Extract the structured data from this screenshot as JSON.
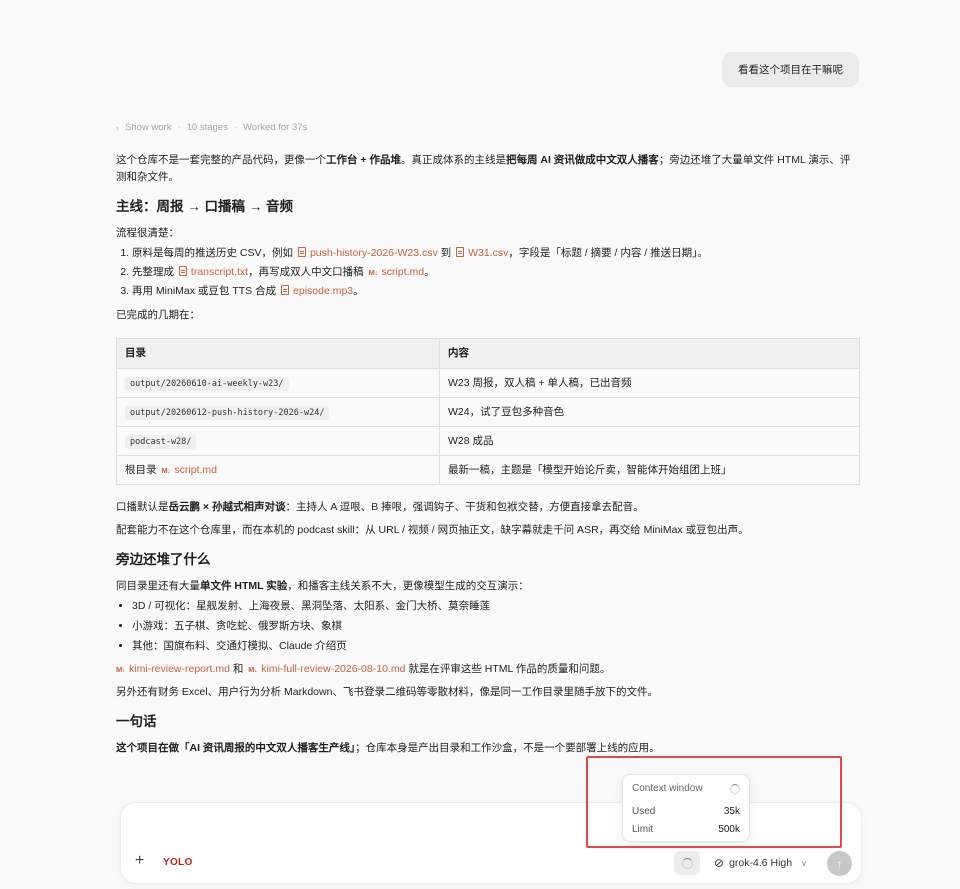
{
  "user_message": "看看这个项目在干嘛呢",
  "show_work": {
    "label": "Show work",
    "stages": "10 stages",
    "worked": "Worked for 37s"
  },
  "intro": {
    "t1": "这个仓库不是一套完整的产品代码，更像一个",
    "b1": "工作台 + 作品堆",
    "t2": "。真正成体系的主线是",
    "b2": "把每周 AI 资讯做成中文双人播客",
    "t3": "；旁边还堆了大量单文件 HTML 演示、评测和杂文件。"
  },
  "section1": {
    "heading": "主线：周报 → 口播稿 → 音频",
    "flow_intro": "流程很清楚：",
    "steps": [
      {
        "a": "原料是每周的推送历史 CSV，例如 ",
        "f1": "push-history-2026-W23.csv",
        "b": " 到 ",
        "f2": "W31.csv",
        "c": "，字段是「标题 / 摘要 / 内容 / 推送日期」。"
      },
      {
        "a": "先整理成 ",
        "f1": "transcript.txt",
        "b": "，再写成双人中文口播稿 ",
        "f2": "script.md",
        "c": "。"
      },
      {
        "a": "再用 MiniMax 或豆包 TTS 合成 ",
        "f1": "episode.mp3",
        "c": "。"
      }
    ],
    "done_label": "已完成的几期在："
  },
  "table": {
    "headers": [
      "目录",
      "内容"
    ],
    "rows": [
      {
        "dir": "output/20260610-ai-weekly-w23/",
        "content": "W23 周报，双人稿 + 单人稿，已出音频"
      },
      {
        "dir": "output/20260612-push-history-2026-w24/",
        "content": "W24，试了豆包多种音色"
      },
      {
        "dir": "podcast-w28/",
        "content": "W28 成品"
      },
      {
        "dir_prefix": "根目录 ",
        "dir_file": "script.md",
        "content": "最新一稿，主题是「模型开始论斤卖，智能体开始组团上班」"
      }
    ]
  },
  "after_table": {
    "p1_a": "口播默认是",
    "p1_b": "岳云鹏 × 孙越式相声对谈",
    "p1_c": "：主持人 A 逗哏、B 捧哏，强调钩子、干货和包袱交替，方便直接拿去配音。",
    "p2": "配套能力不在这个仓库里，而在本机的 podcast skill：从 URL / 视频 / 网页抽正文，缺字幕就走千问 ASR，再交给 MiniMax 或豆包出声。"
  },
  "section2": {
    "heading": "旁边还堆了什么",
    "p_a": "同目录里还有大量",
    "p_b": "单文件 HTML 实验",
    "p_c": "，和播客主线关系不大，更像模型生成的交互演示：",
    "bullets": [
      "3D / 可视化：星舰发射、上海夜景、黑洞坠落、太阳系、金门大桥、莫奈睡莲",
      "小游戏：五子棋、贪吃蛇、俄罗斯方块、象棋",
      "其他：国旗布料、交通灯模拟、Claude 介绍页"
    ],
    "review_f1": "kimi-review-report.md",
    "review_and": " 和 ",
    "review_f2": "kimi-full-review-2026-08-10.md",
    "review_tail": " 就是在评审这些 HTML 作品的质量和问题。",
    "misc": "另外还有财务 Excel、用户行为分析 Markdown、飞书登录二维码等零散材料，像是同一工作目录里随手放下的文件。"
  },
  "section3": {
    "heading": "一句话",
    "b": "这个项目在做「AI 资讯周报的中文双人播客生产线」",
    "tail": "；仓库本身是产出目录和工作沙盒，不是一个要部署上线的应用。"
  },
  "composer": {
    "plus": "+",
    "mode": "YOLO",
    "model": "grok-4.6 High",
    "send_icon": "arrow-up-icon"
  },
  "context_window": {
    "title": "Context window",
    "used_label": "Used",
    "used_value": "35k",
    "limit_label": "Limit",
    "limit_value": "500k"
  },
  "colors": {
    "file_link": "#c6613f",
    "yolo": "#b3261e",
    "highlight_box": "#e14b4b"
  }
}
